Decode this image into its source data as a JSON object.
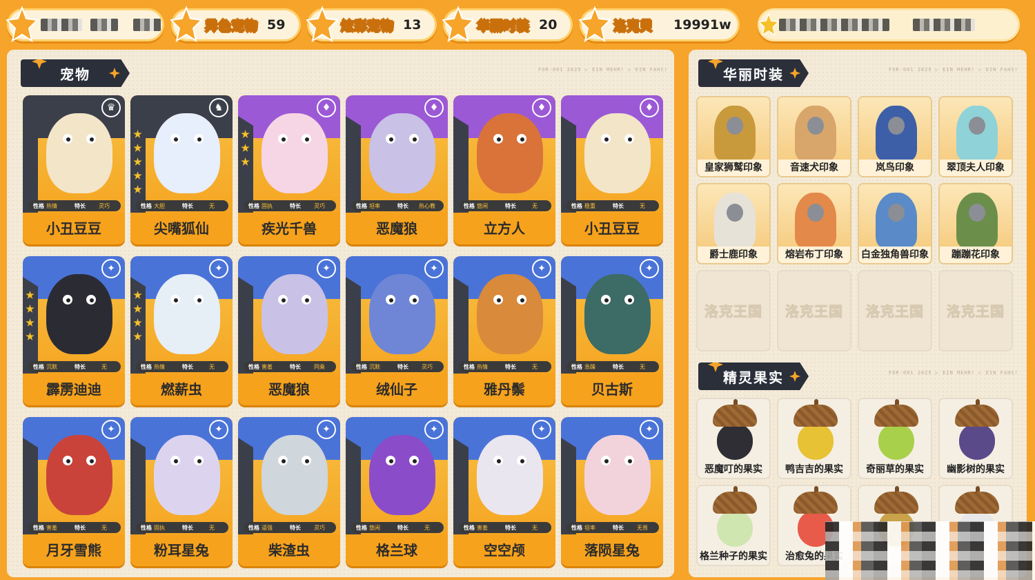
{
  "stats": [
    {
      "label": "",
      "value": ""
    },
    {
      "label": "异色宠物",
      "value": "59"
    },
    {
      "label": "炫彩宠物",
      "value": "13"
    },
    {
      "label": "华丽时装",
      "value": "20"
    },
    {
      "label": "洛克贝",
      "value": "19991w"
    }
  ],
  "pets_panel": {
    "title": "宠物",
    "tiny_text": "FOR-001  2025  ▷ EIN MEHR!  ▷ EIN FAHS!",
    "trait_label": "性格",
    "skill_label": "特长",
    "cards": [
      {
        "name": "小丑豆豆",
        "trait": "热情",
        "skill": "灵巧",
        "theme": "#3b3f4a",
        "body": "#f3e5c8",
        "rank": "♛",
        "stars": 0
      },
      {
        "name": "尖嘴狐仙",
        "trait": "大胆",
        "skill": "无",
        "theme": "#3b3f4a",
        "body": "#e7eefc",
        "rank": "♞",
        "stars": 5
      },
      {
        "name": "疾光千兽",
        "trait": "固执",
        "skill": "灵巧",
        "theme": "#9b59d6",
        "body": "#f6d6e4",
        "rank": "♦",
        "stars": 3
      },
      {
        "name": "恶魔狼",
        "trait": "坦率",
        "skill": "热心教",
        "theme": "#9b59d6",
        "body": "#c9c2e6",
        "rank": "♦",
        "stars": 0
      },
      {
        "name": "立方人",
        "trait": "悠闲",
        "skill": "无",
        "theme": "#9b59d6",
        "body": "#d9733a",
        "rank": "♦",
        "stars": 0
      },
      {
        "name": "小丑豆豆",
        "trait": "稳重",
        "skill": "无",
        "theme": "#9b59d6",
        "body": "#f3e5c8",
        "rank": "♦",
        "stars": 0
      },
      {
        "name": "霹雳迪迪",
        "trait": "沉默",
        "skill": "无",
        "theme": "#4a73d8",
        "body": "#2b2b34",
        "rank": "✦",
        "stars": 4
      },
      {
        "name": "燃薪虫",
        "trait": "热情",
        "skill": "无",
        "theme": "#4a73d8",
        "body": "#e6eef6",
        "rank": "✦",
        "stars": 4
      },
      {
        "name": "恶魔狼",
        "trait": "害羞",
        "skill": "同乘",
        "theme": "#4a73d8",
        "body": "#c9c2e6",
        "rank": "✦",
        "stars": 0
      },
      {
        "name": "绒仙子",
        "trait": "沉默",
        "skill": "灵巧",
        "theme": "#4a73d8",
        "body": "#6f86d6",
        "rank": "✦",
        "stars": 0
      },
      {
        "name": "雅丹鬃",
        "trait": "热情",
        "skill": "无",
        "theme": "#4a73d8",
        "body": "#d98a3a",
        "rank": "✦",
        "stars": 0
      },
      {
        "name": "贝古斯",
        "trait": "急躁",
        "skill": "无",
        "theme": "#4a73d8",
        "body": "#3d6b66",
        "rank": "✦",
        "stars": 0
      },
      {
        "name": "月牙雪熊",
        "trait": "害羞",
        "skill": "无",
        "theme": "#4a73d8",
        "body": "#c9433a",
        "rank": "✦",
        "stars": 0
      },
      {
        "name": "粉耳星兔",
        "trait": "固执",
        "skill": "无",
        "theme": "#4a73d8",
        "body": "#dcd4ef",
        "rank": "✦",
        "stars": 0
      },
      {
        "name": "柴渣虫",
        "trait": "逼强",
        "skill": "灵巧",
        "theme": "#4a73d8",
        "body": "#cfd6dc",
        "rank": "✦",
        "stars": 0
      },
      {
        "name": "格兰球",
        "trait": "悠闲",
        "skill": "无",
        "theme": "#4a73d8",
        "body": "#8a4cc8",
        "rank": "✦",
        "stars": 0
      },
      {
        "name": "空空颅",
        "trait": "害羞",
        "skill": "无",
        "theme": "#4a73d8",
        "body": "#eae6f0",
        "rank": "✦",
        "stars": 0
      },
      {
        "name": "落陨星兔",
        "trait": "坦率",
        "skill": "无畏",
        "theme": "#4a73d8",
        "body": "#f2d3dc",
        "rank": "✦",
        "stars": 0
      }
    ]
  },
  "costume_panel": {
    "title": "华丽时装",
    "tiny_text": "FOR-001  2025  ▷ EIN MEHR!  ▷ EIN FAHS!",
    "items": [
      {
        "label": "皇家狮鹫印象",
        "color": "#c99a3c"
      },
      {
        "label": "音速犬印象",
        "color": "#d8a56a"
      },
      {
        "label": "岚鸟印象",
        "color": "#3d5fa8"
      },
      {
        "label": "翠顶夫人印象",
        "color": "#8fd2d8"
      },
      {
        "label": "爵士鹿印象",
        "color": "#e7e2d8"
      },
      {
        "label": "熔岩布丁印象",
        "color": "#e3894a"
      },
      {
        "label": "白金独角兽印象",
        "color": "#5a8ac8"
      },
      {
        "label": "蹦蹦花印象",
        "color": "#6b8f4a"
      }
    ],
    "empty_label": "洛克王国"
  },
  "fruit_panel": {
    "title": "精灵果实",
    "tiny_text": "FOR-001  2025  ▷ EIN MEHR!  ▷ EIN FAHS!",
    "items": [
      {
        "label": "恶魔叮的果实",
        "color": "#2e2e34"
      },
      {
        "label": "鸭吉吉的果实",
        "color": "#e6c234"
      },
      {
        "label": "奇丽草的果实",
        "color": "#a9d04a"
      },
      {
        "label": "幽影树的果实",
        "color": "#5a4a8a"
      },
      {
        "label": "格兰种子的果实",
        "color": "#cfe6b0"
      },
      {
        "label": "治愈兔的果实",
        "color": "#e85a4a"
      },
      {
        "label": "",
        "color": "#c9a24a"
      },
      {
        "label": "",
        "color": "#e8e8e8"
      }
    ]
  }
}
